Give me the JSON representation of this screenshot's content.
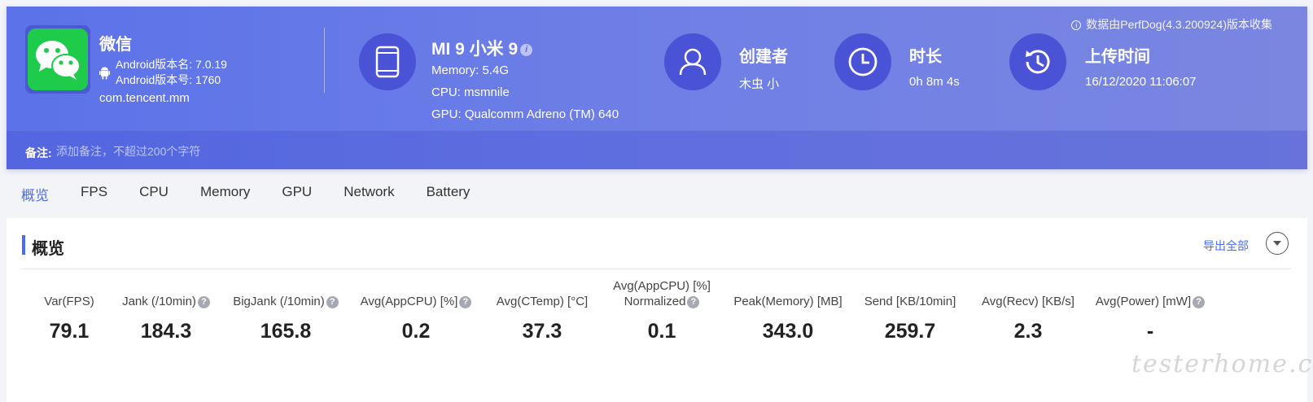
{
  "app": {
    "name": "微信",
    "android_version_name": "Android版本名: 7.0.19",
    "android_version_code": "Android版本号: 1760",
    "package": "com.tencent.mm",
    "icon": "wechat-icon"
  },
  "device": {
    "title": "MI 9 小米 9",
    "info_glyph": "i",
    "memory": "Memory: 5.4G",
    "cpu": "CPU: msmnile",
    "gpu": "GPU: Qualcomm Adreno (TM) 640"
  },
  "stats": {
    "creator_label": "创建者",
    "creator_value": "木虫 小",
    "duration_label": "时长",
    "duration_value": "0h 8m 4s",
    "upload_label": "上传时间",
    "upload_value": "16/12/2020 11:06:07"
  },
  "source_note": "数据由PerfDog(4.3.200924)版本收集",
  "remark": {
    "label": "备注:",
    "placeholder": "添加备注，不超过200个字符"
  },
  "tabs": [
    {
      "label": "概览"
    },
    {
      "label": "FPS"
    },
    {
      "label": "CPU"
    },
    {
      "label": "Memory"
    },
    {
      "label": "GPU"
    },
    {
      "label": "Network"
    },
    {
      "label": "Battery"
    }
  ],
  "panel": {
    "title": "概览",
    "export_label": "导出全部"
  },
  "metrics": [
    {
      "label": "Var(FPS)",
      "value": "79.1"
    },
    {
      "label": "Jank (/10min)",
      "value": "184.3"
    },
    {
      "label": "BigJank (/10min)",
      "value": "165.8"
    },
    {
      "label": "Avg(AppCPU) [%]",
      "value": "0.2"
    },
    {
      "label": "Avg(CTemp) [°C]",
      "value": "37.3"
    },
    {
      "label": "Avg(AppCPU) [%]",
      "label2": "Normalized",
      "value": "0.1"
    },
    {
      "label": "Peak(Memory) [MB]",
      "value": "343.0"
    },
    {
      "label": "Send [KB/10min]",
      "value": "259.7"
    },
    {
      "label": "Avg(Recv) [KB/s]",
      "value": "2.3"
    },
    {
      "label": "Avg(Power) [mW]",
      "value": "-"
    }
  ],
  "help_glyph": "?",
  "watermark": "testerhome.com",
  "colors": {
    "accent": "#4a6df0",
    "header_start": "#5b72e8",
    "header_end": "#7a86e0",
    "wechat_green": "#1fcb4a"
  }
}
